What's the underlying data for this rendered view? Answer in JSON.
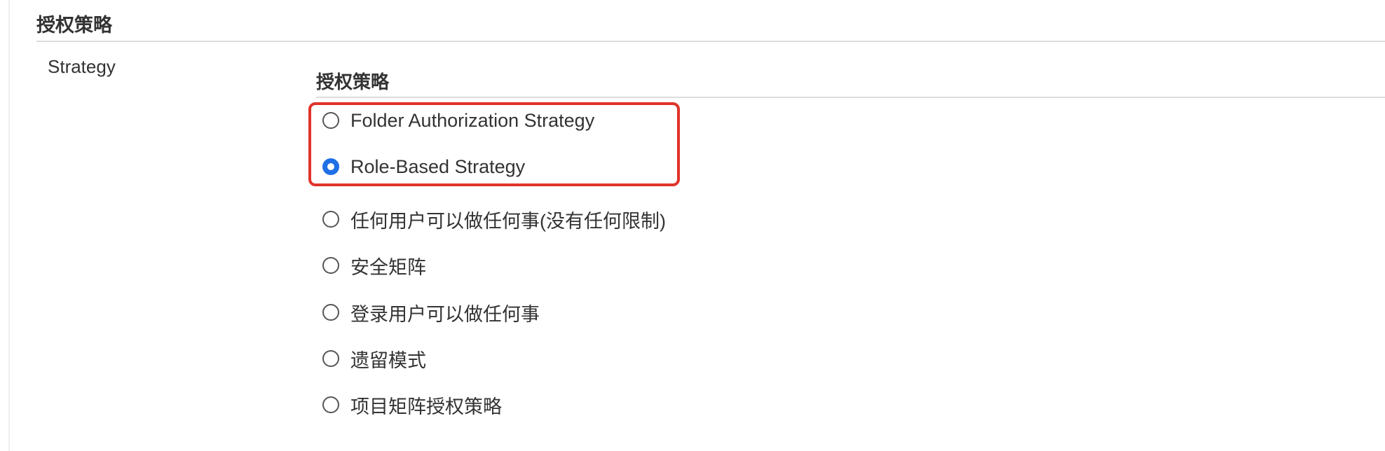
{
  "section": {
    "title": "授权策略"
  },
  "field": {
    "label": "Strategy"
  },
  "group": {
    "title": "授权策略"
  },
  "options": [
    {
      "label": "Folder Authorization Strategy",
      "selected": false
    },
    {
      "label": "Role-Based Strategy",
      "selected": true
    },
    {
      "label": "任何用户可以做任何事(没有任何限制)",
      "selected": false
    },
    {
      "label": "安全矩阵",
      "selected": false
    },
    {
      "label": "登录用户可以做任何事",
      "selected": false
    },
    {
      "label": "遗留模式",
      "selected": false
    },
    {
      "label": "项目矩阵授权策略",
      "selected": false
    }
  ],
  "colors": {
    "accent": "#1f6fe5",
    "highlight": "#e0332a"
  }
}
